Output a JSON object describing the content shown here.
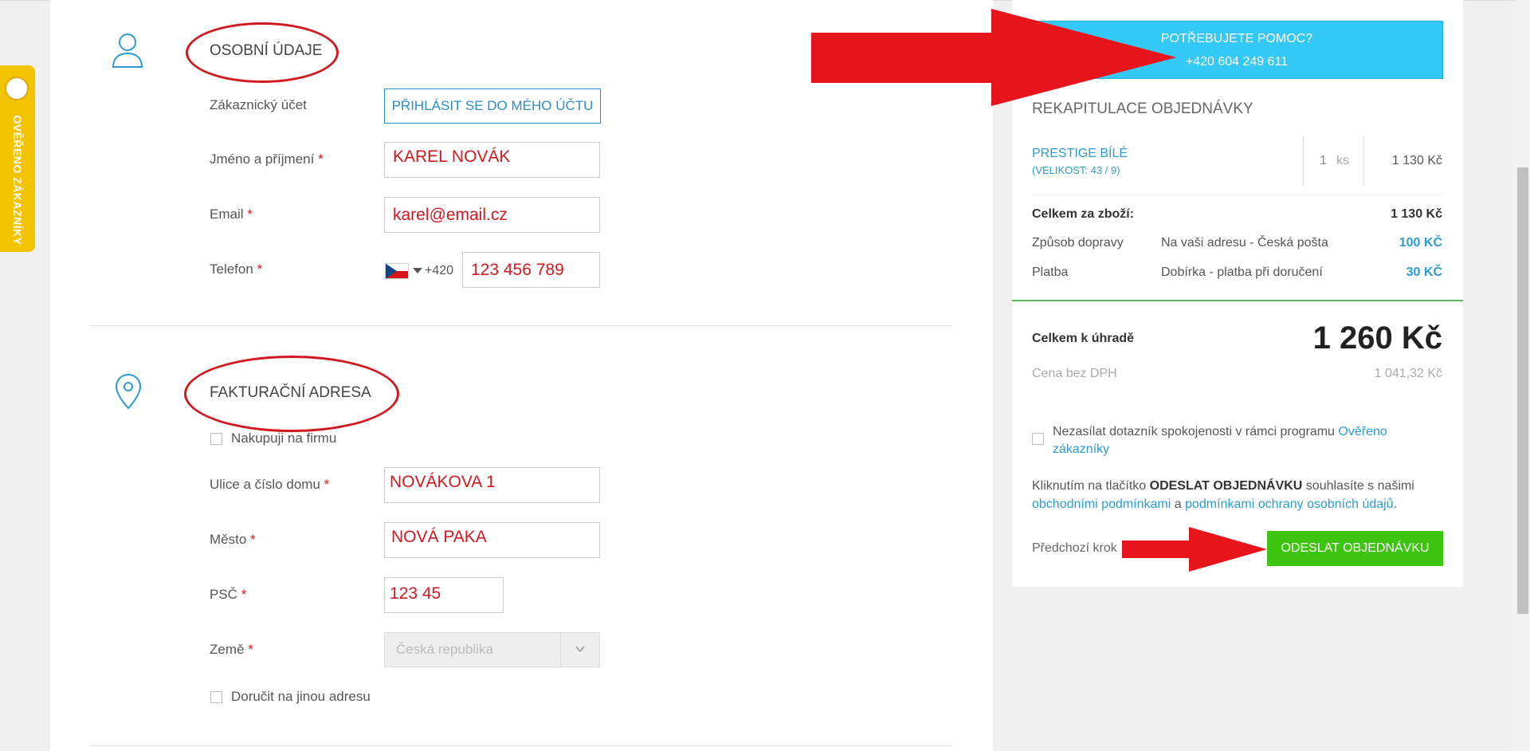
{
  "badge": {
    "text": "OVĚŘENO ZÁKAZNÍKY"
  },
  "personal": {
    "title": "OSOBNÍ ÚDAJE",
    "account_label": "Zákaznický účet",
    "login_button": "PŘIHLÁSIT SE DO MÉHO ÚČTU",
    "name_label": "Jméno a příjmení",
    "name_value": "KAREL NOVÁK",
    "email_label": "Email",
    "email_value": "karel@email.cz",
    "phone_label": "Telefon",
    "phone_prefix": "+420",
    "phone_value": "123 456 789",
    "required_mark": "*"
  },
  "billing": {
    "title": "FAKTURAČNÍ ADRESA",
    "company_checkbox": "Nakupuji na firmu",
    "street_label": "Ulice a číslo domu",
    "street_value": "NOVÁKOVA 1",
    "city_label": "Město",
    "city_value": "NOVÁ PAKA",
    "zip_label": "PSČ",
    "zip_value": "123 45",
    "country_label": "Země",
    "country_value": "Česká republika",
    "other_address_checkbox": "Doručit na jinou adresu"
  },
  "help": {
    "title": "POTŘEBUJETE POMOC?",
    "phone": "+420 604 249 611"
  },
  "summary": {
    "title": "REKAPITULACE OBJEDNÁVKY",
    "product_name": "PRESTIGE BÍLÉ",
    "product_size": "(VELIKOST: 43 / 9)",
    "quantity": "1",
    "quantity_unit": "ks",
    "product_price": "1 130 Kč",
    "goods_total_label": "Celkem za zboží:",
    "goods_total_value": "1 130 Kč",
    "shipping_label": "Způsob dopravy",
    "shipping_method": "Na vaši adresu - Česká pošta",
    "shipping_price": "100 KČ",
    "payment_label": "Platba",
    "payment_method": "Dobírka - platba při doručení",
    "payment_price": "30 KČ",
    "total_label": "Celkem k úhradě",
    "total_value": "1 260 Kč",
    "net_label": "Cena bez DPH",
    "net_value": "1 041,32 Kč",
    "survey_text": "Nezasílat dotazník spokojenosti v rámci programu ",
    "survey_link": "Ověřeno zákazníky",
    "terms_prefix": "Kliknutím na tlačítko ",
    "terms_button_ref": "ODESLAT OBJEDNÁVKU",
    "terms_middle": " souhlasíte s našimi ",
    "terms_link1": "obchodními podmínkami",
    "terms_and": " a ",
    "terms_link2": "podmínkami ochrany osobních údajů",
    "terms_end": ".",
    "prev_step": "Předchozí krok",
    "submit_button": "ODESLAT OBJEDNÁVKU"
  },
  "colors": {
    "accent_blue": "#2a9bd4",
    "help_blue": "#33c8f5",
    "submit_green": "#3cc40e",
    "annotation_red": "#e8141c",
    "badge_yellow": "#f2c300"
  }
}
